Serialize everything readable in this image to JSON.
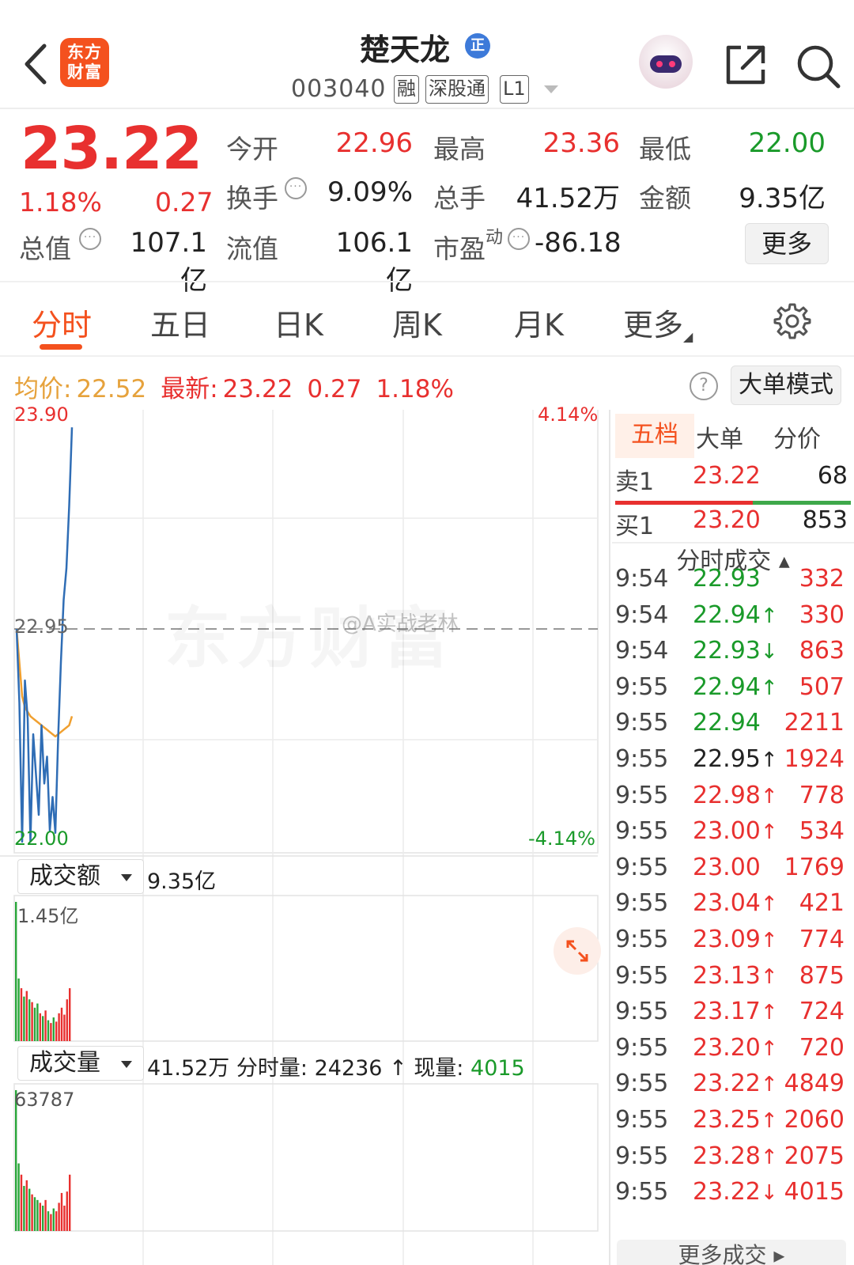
{
  "header": {
    "logo_text": "东方财富",
    "stock_name": "楚天龙",
    "badge": "正",
    "stock_code": "003040",
    "tags": [
      "融",
      "深股通",
      "L1"
    ]
  },
  "quote": {
    "price": "23.22",
    "change_pct": "1.18%",
    "change_amt": "0.27",
    "labels": {
      "open": "今开",
      "high": "最高",
      "low": "最低",
      "turnover": "换手",
      "volume": "总手",
      "amount": "金额",
      "total_mv": "总值",
      "float_mv": "流值",
      "pe": "市盈",
      "pe_sup": "动"
    },
    "values": {
      "open": "22.96",
      "high": "23.36",
      "low": "22.00",
      "turnover": "9.09%",
      "volume": "41.52万",
      "amount": "9.35亿",
      "total_mv": "107.1亿",
      "float_mv": "106.1亿",
      "pe": "-86.18"
    },
    "more_label": "更多"
  },
  "tabs": [
    "分时",
    "五日",
    "日K",
    "周K",
    "月K",
    "更多"
  ],
  "summary": {
    "avg_label": "均价:",
    "avg_value": "22.52",
    "latest_label": "最新:",
    "latest_value": "23.22",
    "change": "0.27",
    "change_pct": "1.18%",
    "help_icon": "?",
    "big_order_btn": "大单模式"
  },
  "chart": {
    "y_top": "23.90",
    "y_mid": "22.95",
    "y_bottom": "22.00",
    "pct_top": "4.14%",
    "pct_bottom": "-4.14%",
    "amount_selector": "成交额",
    "amount_value": "9.35亿",
    "amount_max": "1.45亿",
    "volume_selector": "成交量",
    "volume_info_total": "41.52万",
    "volume_info_label1": "分时量:",
    "volume_info_val1": "24236",
    "volume_info_label2": "现量:",
    "volume_info_val2": "4015",
    "volume_max": "63787",
    "watermark": "东方财富",
    "weibo_watermark": "@A实战老林"
  },
  "chart_data": {
    "type": "line",
    "series": [
      {
        "values": [
          22.95,
          22.62,
          22.0,
          22.72,
          22.55,
          22.0,
          22.48,
          22.3,
          22.12,
          22.52,
          22.26,
          22.38,
          22.05,
          22.2,
          22.04,
          22.46,
          22.8,
          23.08,
          23.22,
          23.5,
          23.85
        ]
      },
      {
        "values": [
          22.95,
          22.8,
          22.65,
          22.6,
          22.58,
          22.56,
          22.55,
          22.54,
          22.53,
          22.52,
          22.51,
          22.5,
          22.49,
          22.48,
          22.47,
          22.48,
          22.49,
          22.5,
          22.51,
          22.52,
          22.56
        ]
      }
    ],
    "ylim": [
      22.0,
      23.9
    ],
    "amount_bars": [
      {
        "v": 1.0,
        "c": "g"
      },
      {
        "v": 0.45,
        "c": "g"
      },
      {
        "v": 0.38,
        "c": "r"
      },
      {
        "v": 0.32,
        "c": "g"
      },
      {
        "v": 0.36,
        "c": "r"
      },
      {
        "v": 0.3,
        "c": "g"
      },
      {
        "v": 0.28,
        "c": "r"
      },
      {
        "v": 0.24,
        "c": "g"
      },
      {
        "v": 0.27,
        "c": "g"
      },
      {
        "v": 0.2,
        "c": "r"
      },
      {
        "v": 0.18,
        "c": "g"
      },
      {
        "v": 0.22,
        "c": "r"
      },
      {
        "v": 0.15,
        "c": "g"
      },
      {
        "v": 0.13,
        "c": "r"
      },
      {
        "v": 0.17,
        "c": "g"
      },
      {
        "v": 0.14,
        "c": "r"
      },
      {
        "v": 0.2,
        "c": "r"
      },
      {
        "v": 0.24,
        "c": "r"
      },
      {
        "v": 0.19,
        "c": "r"
      },
      {
        "v": 0.3,
        "c": "r"
      },
      {
        "v": 0.38,
        "c": "r"
      }
    ],
    "volume_bars": [
      {
        "v": 1.0,
        "c": "g"
      },
      {
        "v": 0.48,
        "c": "g"
      },
      {
        "v": 0.4,
        "c": "r"
      },
      {
        "v": 0.32,
        "c": "g"
      },
      {
        "v": 0.36,
        "c": "r"
      },
      {
        "v": 0.3,
        "c": "g"
      },
      {
        "v": 0.26,
        "c": "r"
      },
      {
        "v": 0.24,
        "c": "g"
      },
      {
        "v": 0.22,
        "c": "g"
      },
      {
        "v": 0.2,
        "c": "r"
      },
      {
        "v": 0.18,
        "c": "g"
      },
      {
        "v": 0.22,
        "c": "r"
      },
      {
        "v": 0.14,
        "c": "g"
      },
      {
        "v": 0.12,
        "c": "r"
      },
      {
        "v": 0.16,
        "c": "g"
      },
      {
        "v": 0.14,
        "c": "r"
      },
      {
        "v": 0.2,
        "c": "r"
      },
      {
        "v": 0.27,
        "c": "r"
      },
      {
        "v": 0.18,
        "c": "r"
      },
      {
        "v": 0.28,
        "c": "r"
      },
      {
        "v": 0.4,
        "c": "r"
      }
    ]
  },
  "right_panel": {
    "tabs": [
      "五档",
      "大单",
      "分价"
    ],
    "sell1": {
      "label": "卖1",
      "price": "23.22",
      "vol": "68"
    },
    "buy1": {
      "label": "买1",
      "price": "23.20",
      "vol": "853"
    },
    "fenshi_title": "分时成交",
    "trades": [
      {
        "time": "9:54",
        "price": "22.93",
        "arrow": "",
        "vol": "332",
        "pc": "green"
      },
      {
        "time": "9:54",
        "price": "22.94",
        "arrow": "↑",
        "vol": "330",
        "pc": "green"
      },
      {
        "time": "9:54",
        "price": "22.93",
        "arrow": "↓",
        "vol": "863",
        "pc": "green"
      },
      {
        "time": "9:55",
        "price": "22.94",
        "arrow": "↑",
        "vol": "507",
        "pc": "green"
      },
      {
        "time": "9:55",
        "price": "22.94",
        "arrow": "",
        "vol": "2211",
        "pc": "green"
      },
      {
        "time": "9:55",
        "price": "22.95",
        "arrow": "↑",
        "vol": "1924",
        "pc": "dark"
      },
      {
        "time": "9:55",
        "price": "22.98",
        "arrow": "↑",
        "vol": "778",
        "pc": "red"
      },
      {
        "time": "9:55",
        "price": "23.00",
        "arrow": "↑",
        "vol": "534",
        "pc": "red"
      },
      {
        "time": "9:55",
        "price": "23.00",
        "arrow": "",
        "vol": "1769",
        "pc": "red"
      },
      {
        "time": "9:55",
        "price": "23.04",
        "arrow": "↑",
        "vol": "421",
        "pc": "red"
      },
      {
        "time": "9:55",
        "price": "23.09",
        "arrow": "↑",
        "vol": "774",
        "pc": "red"
      },
      {
        "time": "9:55",
        "price": "23.13",
        "arrow": "↑",
        "vol": "875",
        "pc": "red"
      },
      {
        "time": "9:55",
        "price": "23.17",
        "arrow": "↑",
        "vol": "724",
        "pc": "red"
      },
      {
        "time": "9:55",
        "price": "23.20",
        "arrow": "↑",
        "vol": "720",
        "pc": "red"
      },
      {
        "time": "9:55",
        "price": "23.22",
        "arrow": "↑",
        "vol": "4849",
        "pc": "red"
      },
      {
        "time": "9:55",
        "price": "23.25",
        "arrow": "↑",
        "vol": "2060",
        "pc": "red"
      },
      {
        "time": "9:55",
        "price": "23.28",
        "arrow": "↑",
        "vol": "2075",
        "pc": "red"
      },
      {
        "time": "9:55",
        "price": "23.22",
        "arrow": "↓",
        "vol": "4015",
        "pc": "red"
      }
    ],
    "more_trades": "更多成交"
  },
  "colors": {
    "up": "#e8302f",
    "down": "#1a9a2a",
    "accent": "#f4511e",
    "price_line": "#2f6db5",
    "avg_line": "#f0a030"
  }
}
